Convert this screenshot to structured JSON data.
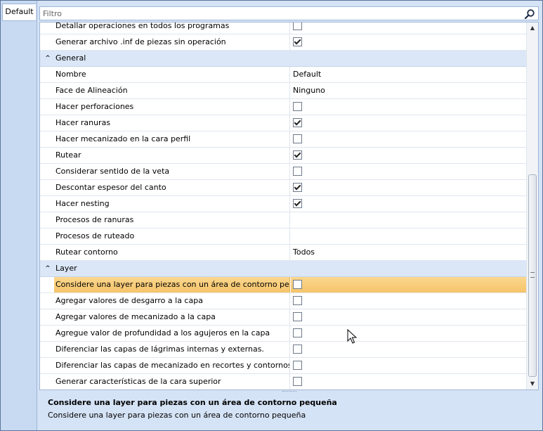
{
  "left_tabs": [
    {
      "label": "Default"
    }
  ],
  "filter": {
    "placeholder": "Filtro",
    "value": ""
  },
  "rows_top": [
    {
      "name": "Detallar operaciones en todos los programas",
      "type": "checkbox",
      "checked": false
    },
    {
      "name": "Generar archivo .inf de piezas sin operación",
      "type": "checkbox",
      "checked": true
    }
  ],
  "categories": [
    {
      "label": "General",
      "expanded_symbol": "^",
      "rows": [
        {
          "name": "Nombre",
          "type": "text",
          "value": "Default"
        },
        {
          "name": "Face de Alineación",
          "type": "text",
          "value": "Ninguno"
        },
        {
          "name": "Hacer perforaciones",
          "type": "checkbox",
          "checked": false
        },
        {
          "name": "Hacer ranuras",
          "type": "checkbox",
          "checked": true
        },
        {
          "name": "Hacer mecanizado en la cara perfil",
          "type": "checkbox",
          "checked": false
        },
        {
          "name": "Rutear",
          "type": "checkbox",
          "checked": true
        },
        {
          "name": "Considerar sentido de la veta",
          "type": "checkbox",
          "checked": false
        },
        {
          "name": "Descontar espesor del canto",
          "type": "checkbox",
          "checked": true
        },
        {
          "name": "Hacer nesting",
          "type": "checkbox",
          "checked": true
        },
        {
          "name": "Procesos de ranuras",
          "type": "text",
          "value": ""
        },
        {
          "name": "Procesos de ruteado",
          "type": "text",
          "value": ""
        },
        {
          "name": "Rutear contorno",
          "type": "text",
          "value": "Todos"
        }
      ]
    },
    {
      "label": "Layer",
      "expanded_symbol": "^",
      "rows": [
        {
          "name": "Considere una layer para piezas con un área de contorno pequeña",
          "type": "checkbox",
          "checked": false,
          "selected": true
        },
        {
          "name": "Agregar valores de desgarro a la capa",
          "type": "checkbox",
          "checked": false
        },
        {
          "name": "Agregar valores de mecanizado a la capa",
          "type": "checkbox",
          "checked": false
        },
        {
          "name": "Agregue valor de profundidad a los agujeros en la capa",
          "type": "checkbox",
          "checked": false
        },
        {
          "name": "Diferenciar las capas de lágrimas internas y externas.",
          "type": "checkbox",
          "checked": false
        },
        {
          "name": "Diferenciar las capas de mecanizado en recortes y contornos",
          "type": "checkbox",
          "checked": false
        },
        {
          "name": "Generar características de la cara superior",
          "type": "checkbox",
          "checked": false
        }
      ]
    }
  ],
  "help": {
    "title": "Considere una layer para piezas con un área de contorno pequeña",
    "description": "Considere una layer para piezas con un área de contorno pequeña"
  },
  "colors": {
    "selection": "#f6c46a",
    "category_bg": "#dbe7f7",
    "panel_bg": "#d5e3f6"
  }
}
